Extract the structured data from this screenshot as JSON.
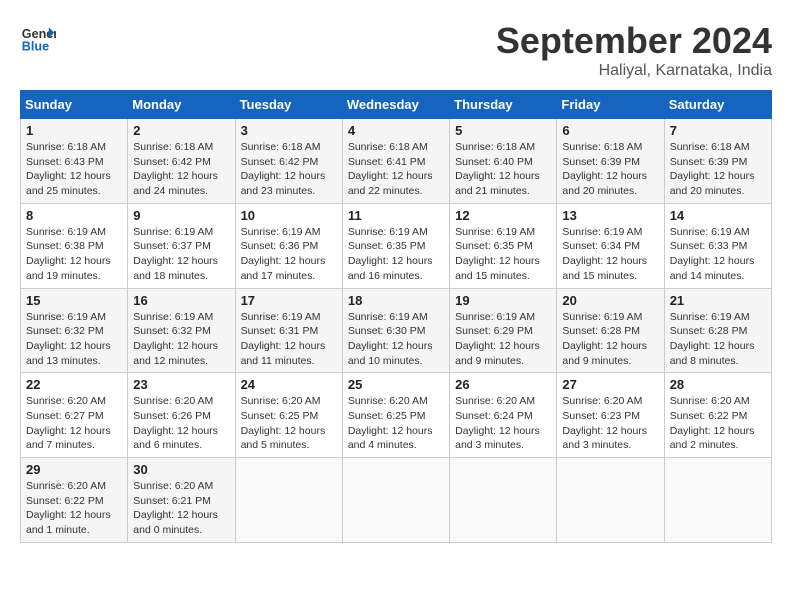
{
  "header": {
    "logo_line1": "General",
    "logo_line2": "Blue",
    "title": "September 2024",
    "subtitle": "Haliyal, Karnataka, India"
  },
  "weekdays": [
    "Sunday",
    "Monday",
    "Tuesday",
    "Wednesday",
    "Thursday",
    "Friday",
    "Saturday"
  ],
  "weeks": [
    [
      {
        "day": "1",
        "info": "Sunrise: 6:18 AM\nSunset: 6:43 PM\nDaylight: 12 hours\nand 25 minutes."
      },
      {
        "day": "2",
        "info": "Sunrise: 6:18 AM\nSunset: 6:42 PM\nDaylight: 12 hours\nand 24 minutes."
      },
      {
        "day": "3",
        "info": "Sunrise: 6:18 AM\nSunset: 6:42 PM\nDaylight: 12 hours\nand 23 minutes."
      },
      {
        "day": "4",
        "info": "Sunrise: 6:18 AM\nSunset: 6:41 PM\nDaylight: 12 hours\nand 22 minutes."
      },
      {
        "day": "5",
        "info": "Sunrise: 6:18 AM\nSunset: 6:40 PM\nDaylight: 12 hours\nand 21 minutes."
      },
      {
        "day": "6",
        "info": "Sunrise: 6:18 AM\nSunset: 6:39 PM\nDaylight: 12 hours\nand 20 minutes."
      },
      {
        "day": "7",
        "info": "Sunrise: 6:18 AM\nSunset: 6:39 PM\nDaylight: 12 hours\nand 20 minutes."
      }
    ],
    [
      {
        "day": "8",
        "info": "Sunrise: 6:19 AM\nSunset: 6:38 PM\nDaylight: 12 hours\nand 19 minutes."
      },
      {
        "day": "9",
        "info": "Sunrise: 6:19 AM\nSunset: 6:37 PM\nDaylight: 12 hours\nand 18 minutes."
      },
      {
        "day": "10",
        "info": "Sunrise: 6:19 AM\nSunset: 6:36 PM\nDaylight: 12 hours\nand 17 minutes."
      },
      {
        "day": "11",
        "info": "Sunrise: 6:19 AM\nSunset: 6:35 PM\nDaylight: 12 hours\nand 16 minutes."
      },
      {
        "day": "12",
        "info": "Sunrise: 6:19 AM\nSunset: 6:35 PM\nDaylight: 12 hours\nand 15 minutes."
      },
      {
        "day": "13",
        "info": "Sunrise: 6:19 AM\nSunset: 6:34 PM\nDaylight: 12 hours\nand 15 minutes."
      },
      {
        "day": "14",
        "info": "Sunrise: 6:19 AM\nSunset: 6:33 PM\nDaylight: 12 hours\nand 14 minutes."
      }
    ],
    [
      {
        "day": "15",
        "info": "Sunrise: 6:19 AM\nSunset: 6:32 PM\nDaylight: 12 hours\nand 13 minutes."
      },
      {
        "day": "16",
        "info": "Sunrise: 6:19 AM\nSunset: 6:32 PM\nDaylight: 12 hours\nand 12 minutes."
      },
      {
        "day": "17",
        "info": "Sunrise: 6:19 AM\nSunset: 6:31 PM\nDaylight: 12 hours\nand 11 minutes."
      },
      {
        "day": "18",
        "info": "Sunrise: 6:19 AM\nSunset: 6:30 PM\nDaylight: 12 hours\nand 10 minutes."
      },
      {
        "day": "19",
        "info": "Sunrise: 6:19 AM\nSunset: 6:29 PM\nDaylight: 12 hours\nand 9 minutes."
      },
      {
        "day": "20",
        "info": "Sunrise: 6:19 AM\nSunset: 6:28 PM\nDaylight: 12 hours\nand 9 minutes."
      },
      {
        "day": "21",
        "info": "Sunrise: 6:19 AM\nSunset: 6:28 PM\nDaylight: 12 hours\nand 8 minutes."
      }
    ],
    [
      {
        "day": "22",
        "info": "Sunrise: 6:20 AM\nSunset: 6:27 PM\nDaylight: 12 hours\nand 7 minutes."
      },
      {
        "day": "23",
        "info": "Sunrise: 6:20 AM\nSunset: 6:26 PM\nDaylight: 12 hours\nand 6 minutes."
      },
      {
        "day": "24",
        "info": "Sunrise: 6:20 AM\nSunset: 6:25 PM\nDaylight: 12 hours\nand 5 minutes."
      },
      {
        "day": "25",
        "info": "Sunrise: 6:20 AM\nSunset: 6:25 PM\nDaylight: 12 hours\nand 4 minutes."
      },
      {
        "day": "26",
        "info": "Sunrise: 6:20 AM\nSunset: 6:24 PM\nDaylight: 12 hours\nand 3 minutes."
      },
      {
        "day": "27",
        "info": "Sunrise: 6:20 AM\nSunset: 6:23 PM\nDaylight: 12 hours\nand 3 minutes."
      },
      {
        "day": "28",
        "info": "Sunrise: 6:20 AM\nSunset: 6:22 PM\nDaylight: 12 hours\nand 2 minutes."
      }
    ],
    [
      {
        "day": "29",
        "info": "Sunrise: 6:20 AM\nSunset: 6:22 PM\nDaylight: 12 hours\nand 1 minute."
      },
      {
        "day": "30",
        "info": "Sunrise: 6:20 AM\nSunset: 6:21 PM\nDaylight: 12 hours\nand 0 minutes."
      },
      {
        "day": "",
        "info": ""
      },
      {
        "day": "",
        "info": ""
      },
      {
        "day": "",
        "info": ""
      },
      {
        "day": "",
        "info": ""
      },
      {
        "day": "",
        "info": ""
      }
    ]
  ]
}
